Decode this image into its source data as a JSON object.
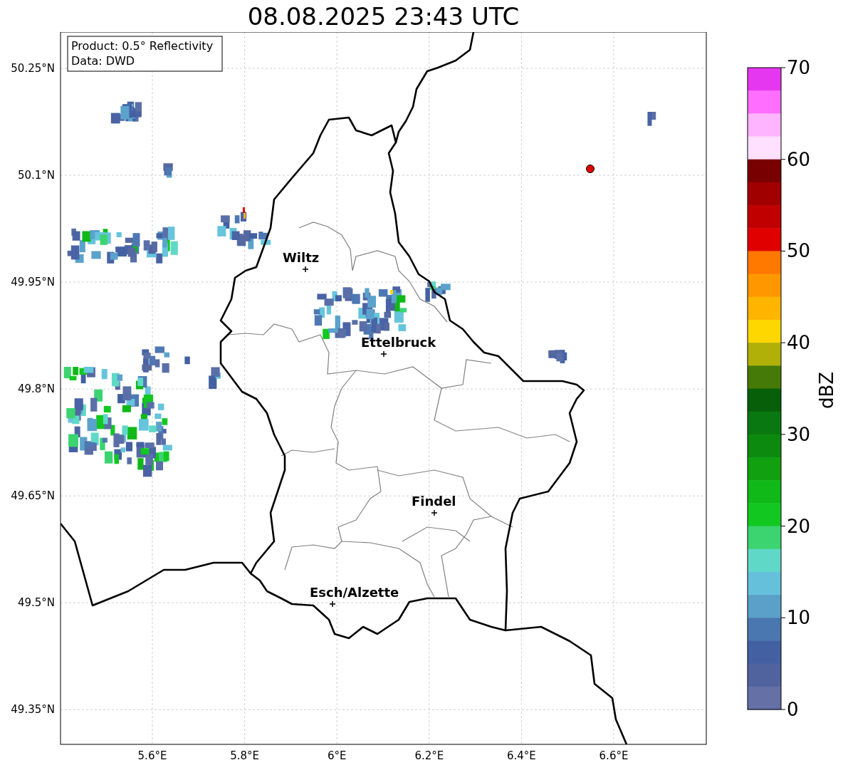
{
  "title": "08.08.2025 23:43 UTC",
  "map": {
    "info_box": [
      "Product: 0.5° Reflectivity",
      "Data: DWD"
    ],
    "lat_ticks": [
      "50.25°N",
      "50.1°N",
      "49.95°N",
      "49.8°N",
      "49.65°N",
      "49.5°N",
      "49.35°N"
    ],
    "lon_ticks": [
      "5.6°E",
      "5.8°E",
      "6°E",
      "6.2°E",
      "6.4°E",
      "6.6°E"
    ],
    "cities": [
      {
        "name": "Wiltz"
      },
      {
        "name": "Ettelbruck"
      },
      {
        "name": "Findel"
      },
      {
        "name": "Esch/Alzette"
      }
    ]
  },
  "colorbar": {
    "label": "dBZ",
    "ticks": [
      "70",
      "60",
      "50",
      "40",
      "30",
      "20",
      "10",
      "0"
    ],
    "bins": [
      {
        "color": "#e637f0"
      },
      {
        "color": "#ff6eff"
      },
      {
        "color": "#ffb4ff"
      },
      {
        "color": "#ffe0ff"
      },
      {
        "color": "#780000"
      },
      {
        "color": "#a00000"
      },
      {
        "color": "#c00000"
      },
      {
        "color": "#e00000"
      },
      {
        "color": "#ff7800"
      },
      {
        "color": "#ff9800"
      },
      {
        "color": "#ffb400"
      },
      {
        "color": "#ffd700"
      },
      {
        "color": "#b0b008"
      },
      {
        "color": "#457a08"
      },
      {
        "color": "#075f0a"
      },
      {
        "color": "#0a7810"
      },
      {
        "color": "#0c8a10"
      },
      {
        "color": "#10a010"
      },
      {
        "color": "#10b818"
      },
      {
        "color": "#12c820"
      },
      {
        "color": "#3cd470"
      },
      {
        "color": "#60d8c8"
      },
      {
        "color": "#65c0dc"
      },
      {
        "color": "#5aa0c8"
      },
      {
        "color": "#4a77b0"
      },
      {
        "color": "#4361a2"
      },
      {
        "color": "#51639f"
      },
      {
        "color": "#6470a6"
      }
    ]
  }
}
